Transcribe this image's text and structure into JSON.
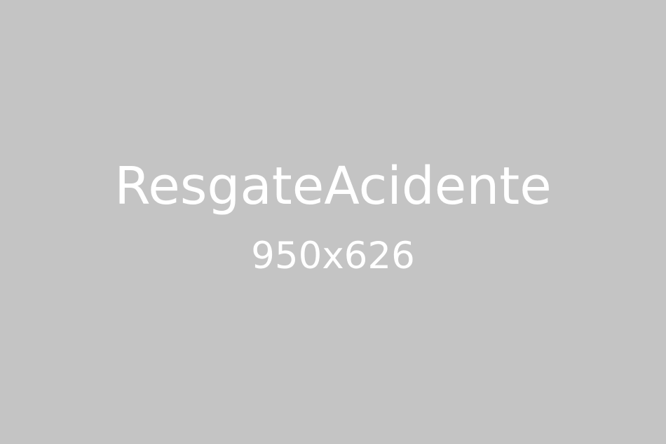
{
  "placeholder": {
    "title": "ResgateAcidente",
    "dimensions": "950x626",
    "background_color": "#c4c4c4",
    "text_color": "#ffffff"
  }
}
